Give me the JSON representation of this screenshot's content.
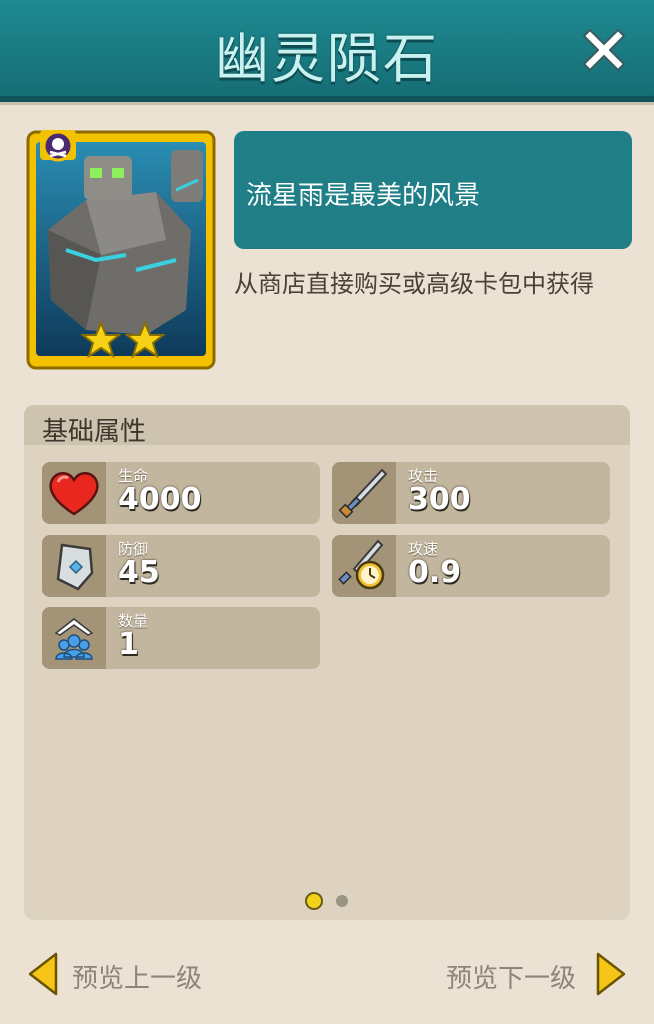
{
  "header": {
    "title": "幽灵陨石"
  },
  "card": {
    "stars": 2
  },
  "description": "流星雨是最美的风景",
  "source_text": "从商店直接购买或高级卡包中获得",
  "attributes": {
    "section_title": "基础属性",
    "stats": [
      {
        "label": "生命",
        "value": "4000",
        "icon": "heart-icon"
      },
      {
        "label": "攻击",
        "value": "300",
        "icon": "sword-icon"
      },
      {
        "label": "防御",
        "value": "45",
        "icon": "shield-icon"
      },
      {
        "label": "攻速",
        "value": "0.9",
        "icon": "attack-speed-icon"
      },
      {
        "label": "数量",
        "value": "1",
        "icon": "unit-count-icon"
      }
    ]
  },
  "pagination": {
    "current": 1,
    "total": 2
  },
  "nav": {
    "prev_label": "预览上一级",
    "next_label": "预览下一级"
  },
  "colors": {
    "header": "#1f8a92",
    "desc_box": "#1f7e86",
    "card_frame": "#f2c200",
    "panel": "#ebe2d3"
  }
}
